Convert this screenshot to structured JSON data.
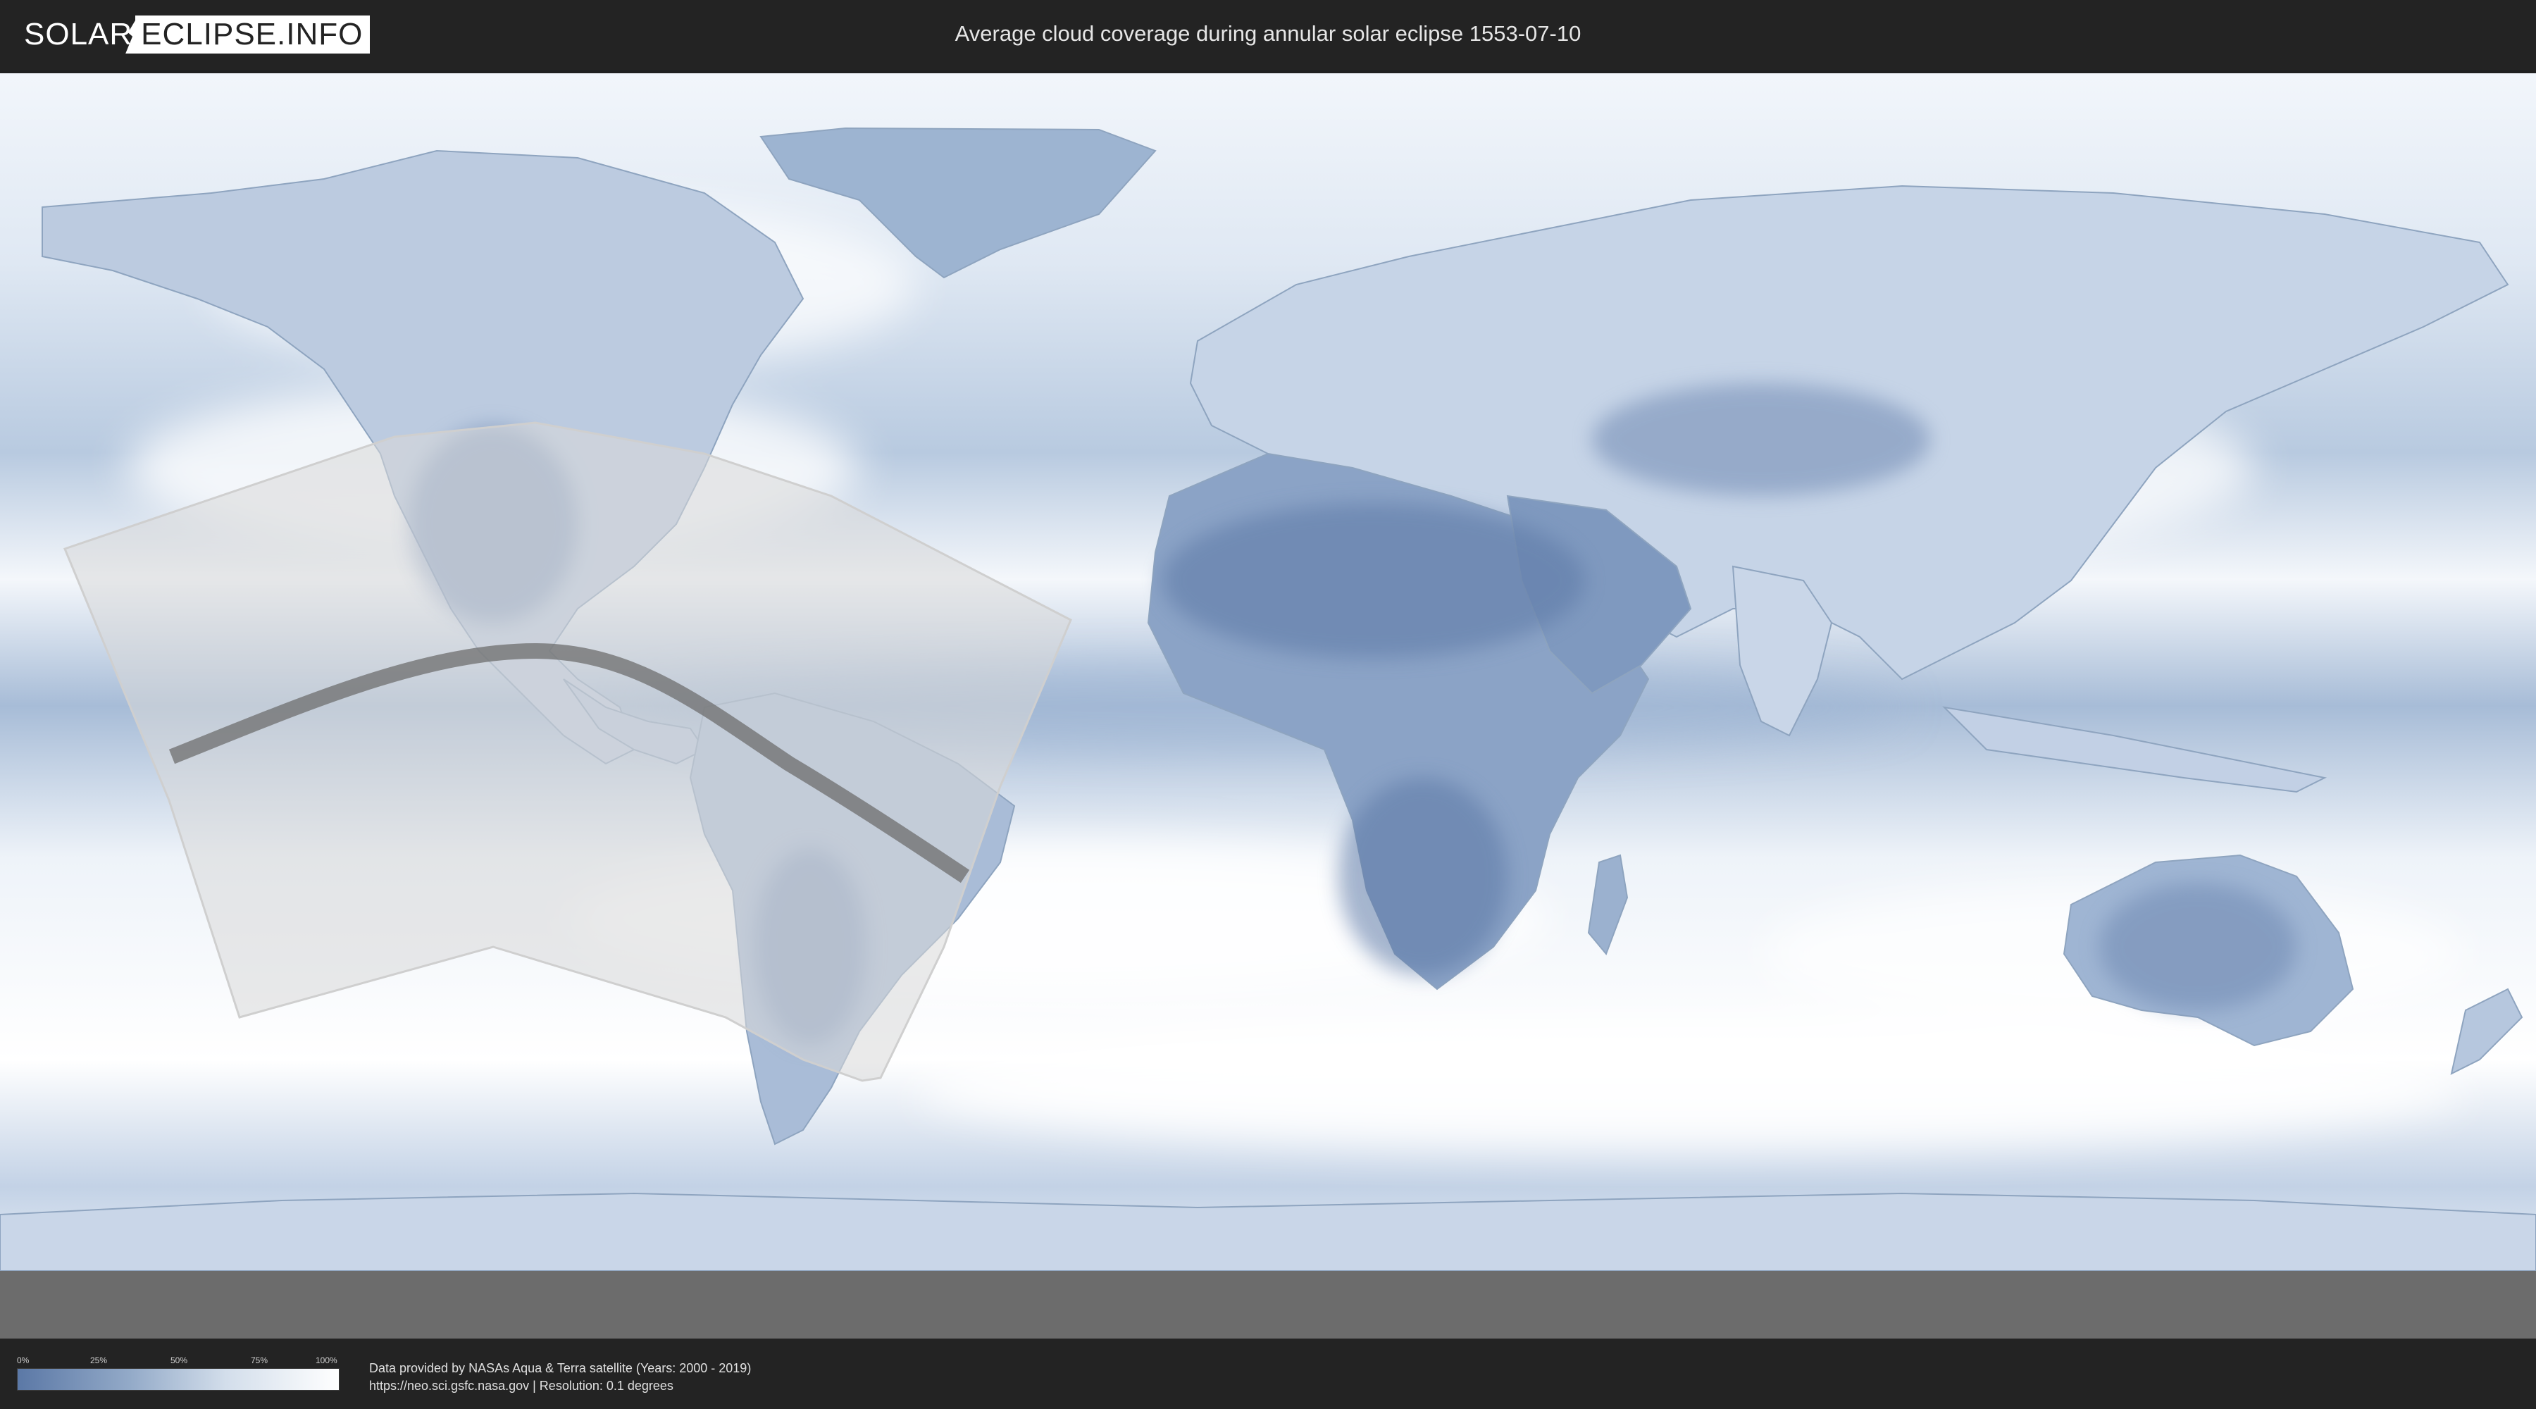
{
  "header": {
    "logo_left": "SOLAR",
    "logo_right": "ECLIPSE.INFO",
    "title": "Average cloud coverage during annular solar eclipse 1553-07-10"
  },
  "map": {
    "type": "cloud coverage world map",
    "colors": {
      "cloudy": "#ffffff",
      "clear": "#5b78a6",
      "eclipse_visibility_overlay": "#d8d8d8",
      "annularity_path": "#6e6e6e"
    }
  },
  "legend": {
    "ticks": [
      "0%",
      "25%",
      "50%",
      "75%",
      "100%"
    ]
  },
  "credits": {
    "line1": "Data provided by NASAs Aqua & Terra satellite (Years: 2000 - 2019)",
    "line2": "https://neo.sci.gsfc.nasa.gov | Resolution: 0.1 degrees"
  }
}
